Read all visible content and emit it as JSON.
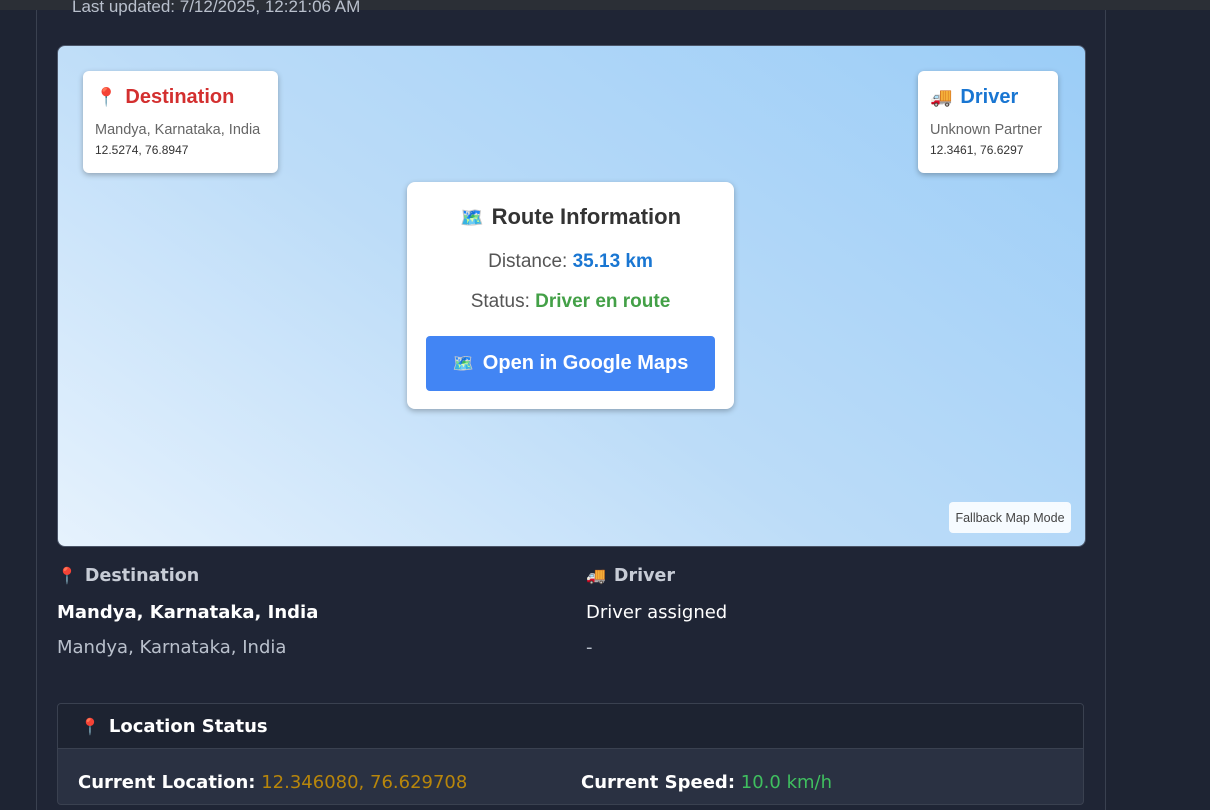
{
  "header": {
    "last_updated": "Last updated: 7/12/2025, 12:21:06 AM"
  },
  "map": {
    "destination_card": {
      "icon": "📍",
      "title": "Destination",
      "address": "Mandya, Karnataka, India",
      "coords": "12.5274, 76.8947"
    },
    "driver_card": {
      "icon": "🚚",
      "title": "Driver",
      "name": "Unknown Partner",
      "coords": "12.3461, 76.6297"
    },
    "route_card": {
      "icon": "🗺️",
      "title": "Route Information",
      "distance_label": "Distance:",
      "distance_value": "35.13 km",
      "status_label": "Status:",
      "status_value": "Driver en route",
      "button_icon": "🗺️",
      "button_label": "Open in Google Maps"
    },
    "mode_badge": "Fallback Map Mode"
  },
  "info": {
    "destination": {
      "icon": "📍",
      "heading": "Destination",
      "name": "Mandya, Karnataka, India",
      "address": "Mandya, Karnataka, India"
    },
    "driver": {
      "icon": "🚚",
      "heading": "Driver",
      "status": "Driver assigned",
      "detail": "-"
    }
  },
  "location_status": {
    "icon": "📍",
    "title": "Location Status",
    "current_location_label": "Current Location:",
    "current_location_value": "12.346080, 76.629708",
    "current_speed_label": "Current Speed:",
    "current_speed_value": "10.0 km/h"
  },
  "colors": {
    "destination_accent": "#d32f2f",
    "driver_accent": "#1976d2",
    "status_green": "#43a047",
    "google_blue": "#4285f4",
    "location_value": "#b8860b",
    "speed_value": "#3fbf5f"
  }
}
